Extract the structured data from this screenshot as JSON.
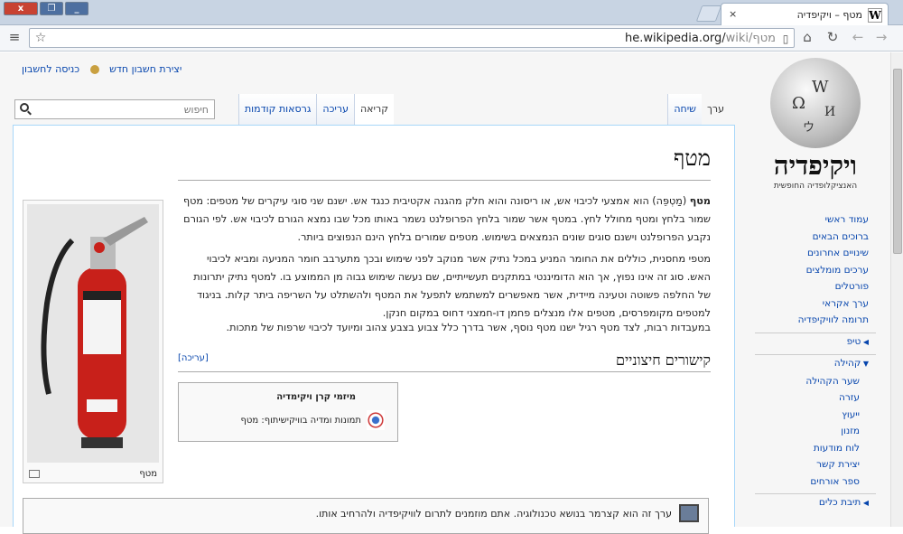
{
  "window": {
    "minimize": "_",
    "restore": "❐",
    "close": "x"
  },
  "tab": {
    "title": "מטף – ויקיפדיה",
    "favicon": "W",
    "close": "×"
  },
  "toolbar": {
    "url_host": "he.wikipedia.org/",
    "url_path": "wiki/",
    "url_rest": "מטף",
    "icons": [
      "wrench-icon",
      "page-icon",
      "home-icon",
      "reload-icon",
      "back-icon",
      "forward-icon",
      "star-icon"
    ]
  },
  "personal": {
    "create_account": "יצירת חשבון חדש",
    "login": "כניסה לחשבון"
  },
  "tabs": {
    "article": "ערך",
    "talk": "שיחה",
    "read": "קריאה",
    "edit": "עריכה",
    "history": "גרסאות קודמות"
  },
  "search": {
    "placeholder": "חיפוש"
  },
  "logo": {
    "wordmark": "ויקיפדיה",
    "tagline": "האנציקלופדיה החופשית"
  },
  "sidebar": {
    "nav": [
      "עמוד ראשי",
      "ברוכים הבאים",
      "שינויים אחרונים",
      "ערכים מומלצים",
      "פורטלים",
      "ערך אקראי",
      "תרומה לוויקיפדיה"
    ],
    "tip": "טיפ",
    "community": "קהילה",
    "community_items": [
      "שער הקהילה",
      "עזרה",
      "ייעוץ",
      "מזנון",
      "לוח מודעות",
      "יצירת קשר",
      "ספר אורחים"
    ],
    "toolbox": "תיבת כלים"
  },
  "article": {
    "title": "מטף",
    "para1_b": "מטף",
    "para1": " (מַטְפֵּה) הוא אמצעי לכיבוי אש, או ריסונה והוא חלק מהגנה אקטיבית כנגד אש. ישנם שני סוגי עיקרים של מטפים: מטף שמור בלחץ ומטף מחולל לחץ. במטף אשר שמור בלחץ הפרופלנט נשמר באותו מכל שבו נמצא הגורם לכיבוי אש. לפי הגורם נקבע הפרופלנט וישנם סוגים שונים הנמצאים בשימוש. מטפים שמורים בלחץ הינם הנפוצים ביותר.",
    "para2": "מטפי מחסנית, כוללים את החומר המניע במכל נתיק אשר מנוקב לפני שימוש ובכך מתערבב חומר המניעה ומביא לכיבוי האש. סוג זה אינו נפוץ, אך הוא הדומיננטי במתקנים תעשייתיים, שם נעשה שימוש גבוה מן הממוצע בו. למטף נתיק יתרונות של החלפה פשוטה וטעינה מיידית, אשר מאפשרים למשתמש לתפעל את המטף ולהשתלט על השריפה ביתר קלות. בניגוד למטפים מקומפרסים, מטפים אלו מנצלים פחמן דו-חמצני דחוס במקום חנקן.",
    "para3": "במעבדות רבות, לצד מטף רגיל ישנו מטף נוסף, אשר בדרך כלל צבוע בצבע צהוב ומיועד לכיבוי שרפות של מתכות.",
    "image_caption": "מטף",
    "ext_heading": "קישורים חיצוניים",
    "ext_edit": "[עריכה]",
    "commons_title": "מיזמי קרן ויקימדיה",
    "commons_text": "תמונות ומדיה בוויקישיתוף: מטף",
    "stub_text": "ערך זה הוא קצרמר בנושא טכנולוגיה. אתם מוזמנים לתרום לוויקיפדיה ולהרחיב אותו."
  }
}
